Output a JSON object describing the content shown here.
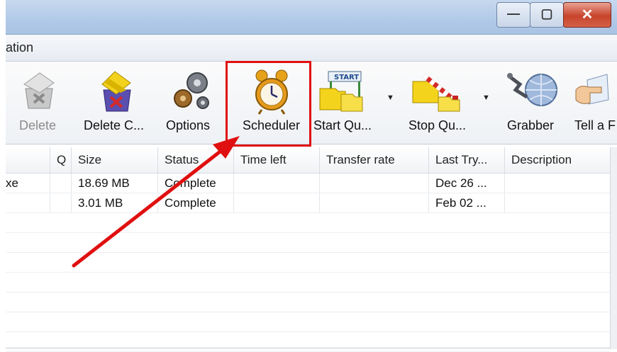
{
  "window": {
    "minimize_glyph": "—",
    "maximize_glyph": "▢",
    "close_glyph": "✕"
  },
  "menu": {
    "partial_item": "ation"
  },
  "toolbar": {
    "buttons": [
      {
        "label": "Delete",
        "icon": "delete-box-icon",
        "enabled": false
      },
      {
        "label": "Delete C...",
        "icon": "delete-completed-box-icon",
        "enabled": true
      },
      {
        "label": "Options",
        "icon": "gears-icon",
        "enabled": true
      },
      {
        "label": "Scheduler",
        "icon": "alarm-clock-icon",
        "enabled": true,
        "highlighted": true
      },
      {
        "label": "Start Qu...",
        "icon": "start-flag-folder-icon",
        "enabled": true,
        "dropdown": true
      },
      {
        "label": "Stop Qu...",
        "icon": "stop-barrier-folder-icon",
        "enabled": true,
        "dropdown": true
      },
      {
        "label": "Grabber",
        "icon": "grabber-globe-icon",
        "enabled": true
      },
      {
        "label": "Tell a F",
        "icon": "tell-friend-icon",
        "enabled": true
      }
    ],
    "dropdown_glyph": "▼"
  },
  "table": {
    "columns": [
      "",
      "Q",
      "Size",
      "Status",
      "Time left",
      "Transfer rate",
      "Last Try...",
      "Description"
    ],
    "rows": [
      {
        "name": "xe",
        "q": "",
        "size": "18.69 MB",
        "status": "Complete",
        "time_left": "",
        "rate": "",
        "last_try": "Dec 26 ...",
        "desc": ""
      },
      {
        "name": "",
        "q": "",
        "size": "3.01 MB",
        "status": "Complete",
        "time_left": "",
        "rate": "",
        "last_try": "Feb 02 ...",
        "desc": ""
      }
    ]
  },
  "annotation": {
    "color": "#e01010"
  }
}
